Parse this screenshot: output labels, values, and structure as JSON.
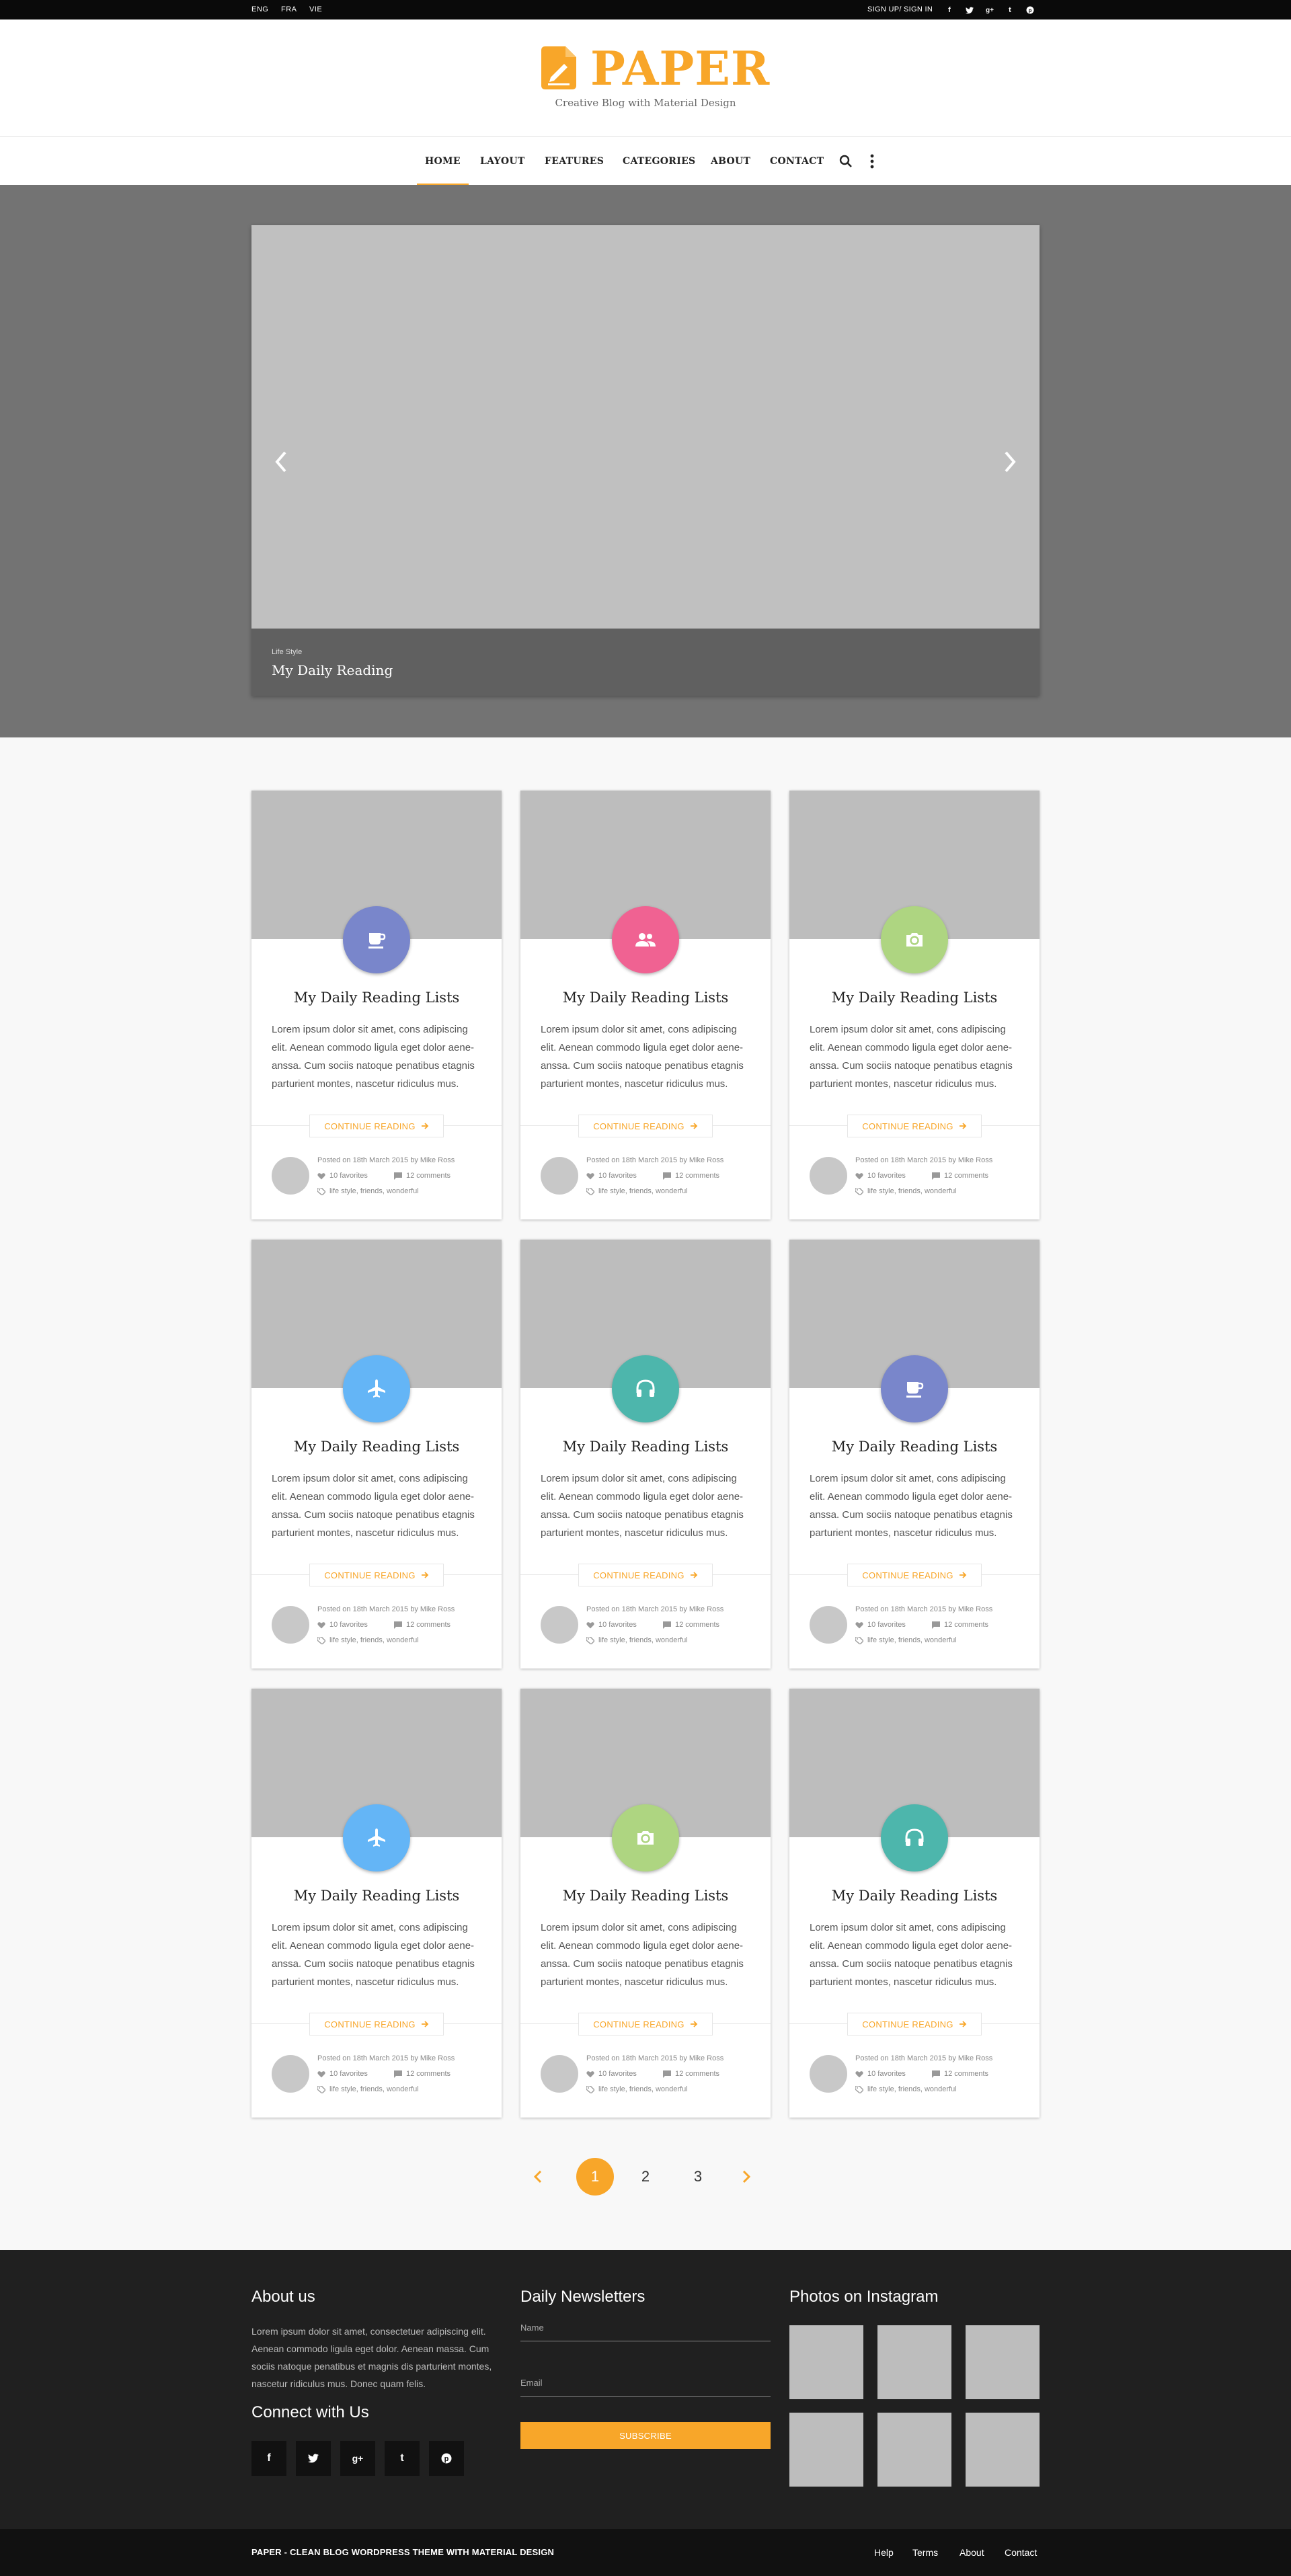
{
  "topbar": {
    "languages": [
      "ENG",
      "FRA",
      "VIE"
    ],
    "signin": "SIGN UP/ SIGN IN",
    "social_icons": [
      "facebook-icon",
      "twitter-icon",
      "google-plus-icon",
      "tumblr-icon",
      "pinterest-icon"
    ]
  },
  "header": {
    "logo": "PAPER",
    "tagline": "Creative Blog with Material Design",
    "accent_color": "#f8a629"
  },
  "nav": {
    "items": [
      "HOME",
      "LAYOUT",
      "FEATURES",
      "CATEGORIES",
      "ABOUT",
      "CONTACT"
    ],
    "active": "HOME"
  },
  "slider": {
    "category": "Life Style",
    "title": "My Daily Reading"
  },
  "cards": [
    {
      "icon": "coffee-icon",
      "color": "#7986cb",
      "title": "My Daily Reading Lists",
      "text": "Lorem ipsum dolor sit amet, cons adipiscing elit. Aenean commodo ligula eget dolor aene-anssa. Cum sociis natoque penatibus etagnis parturient montes, nascetur ridiculus mus.",
      "button": "CONTINUE READING",
      "posted": "Posted on 18th March 2015 by Mike Ross",
      "favorites": "10 favorites",
      "comments": "12 comments",
      "tags": "life style, friends, wonderful"
    },
    {
      "icon": "people-icon",
      "color": "#f06292",
      "title": "My Daily Reading Lists",
      "text": "Lorem ipsum dolor sit amet, cons adipiscing elit. Aenean commodo ligula eget dolor aene-anssa. Cum sociis natoque penatibus etagnis parturient montes, nascetur ridiculus mus.",
      "button": "CONTINUE READING",
      "posted": "Posted on 18th March 2015 by Mike Ross",
      "favorites": "10 favorites",
      "comments": "12 comments",
      "tags": "life style, friends, wonderful"
    },
    {
      "icon": "camera-icon",
      "color": "#aed581",
      "title": "My Daily Reading Lists",
      "text": "Lorem ipsum dolor sit amet, cons adipiscing elit. Aenean commodo ligula eget dolor aene-anssa. Cum sociis natoque penatibus etagnis parturient montes, nascetur ridiculus mus.",
      "button": "CONTINUE READING",
      "posted": "Posted on 18th March 2015 by Mike Ross",
      "favorites": "10 favorites",
      "comments": "12 comments",
      "tags": "life style, friends, wonderful"
    },
    {
      "icon": "airplane-icon",
      "color": "#64b5f6",
      "title": "My Daily Reading Lists",
      "text": "Lorem ipsum dolor sit amet, cons adipiscing elit. Aenean commodo ligula eget dolor aene-anssa. Cum sociis natoque penatibus etagnis parturient montes, nascetur ridiculus mus.",
      "button": "CONTINUE READING",
      "posted": "Posted on 18th March 2015 by Mike Ross",
      "favorites": "10 favorites",
      "comments": "12 comments",
      "tags": "life style, friends, wonderful"
    },
    {
      "icon": "headphones-icon",
      "color": "#4db6ac",
      "title": "My Daily Reading Lists",
      "text": "Lorem ipsum dolor sit amet, cons adipiscing elit. Aenean commodo ligula eget dolor aene-anssa. Cum sociis natoque penatibus etagnis parturient montes, nascetur ridiculus mus.",
      "button": "CONTINUE READING",
      "posted": "Posted on 18th March 2015 by Mike Ross",
      "favorites": "10 favorites",
      "comments": "12 comments",
      "tags": "life style, friends, wonderful"
    },
    {
      "icon": "coffee-icon",
      "color": "#7986cb",
      "title": "My Daily Reading Lists",
      "text": "Lorem ipsum dolor sit amet, cons adipiscing elit. Aenean commodo ligula eget dolor aene-anssa. Cum sociis natoque penatibus etagnis parturient montes, nascetur ridiculus mus.",
      "button": "CONTINUE READING",
      "posted": "Posted on 18th March 2015 by Mike Ross",
      "favorites": "10 favorites",
      "comments": "12 comments",
      "tags": "life style, friends, wonderful"
    },
    {
      "icon": "airplane-icon",
      "color": "#64b5f6",
      "title": "My Daily Reading Lists",
      "text": "Lorem ipsum dolor sit amet, cons adipiscing elit. Aenean commodo ligula eget dolor aene-anssa. Cum sociis natoque penatibus etagnis parturient montes, nascetur ridiculus mus.",
      "button": "CONTINUE READING",
      "posted": "Posted on 18th March 2015 by Mike Ross",
      "favorites": "10 favorites",
      "comments": "12 comments",
      "tags": "life style, friends, wonderful"
    },
    {
      "icon": "camera-icon",
      "color": "#aed581",
      "title": "My Daily Reading Lists",
      "text": "Lorem ipsum dolor sit amet, cons adipiscing elit. Aenean commodo ligula eget dolor aene-anssa. Cum sociis natoque penatibus etagnis parturient montes, nascetur ridiculus mus.",
      "button": "CONTINUE READING",
      "posted": "Posted on 18th March 2015 by Mike Ross",
      "favorites": "10 favorites",
      "comments": "12 comments",
      "tags": "life style, friends, wonderful"
    },
    {
      "icon": "headphones-icon",
      "color": "#4db6ac",
      "title": "My Daily Reading Lists",
      "text": "Lorem ipsum dolor sit amet, cons adipiscing elit. Aenean commodo ligula eget dolor aene-anssa. Cum sociis natoque penatibus etagnis parturient montes, nascetur ridiculus mus.",
      "button": "CONTINUE READING",
      "posted": "Posted on 18th March 2015 by Mike Ross",
      "favorites": "10 favorites",
      "comments": "12 comments",
      "tags": "life style, friends, wonderful"
    }
  ],
  "pagination": {
    "pages": [
      "1",
      "2",
      "3"
    ],
    "current": "1"
  },
  "footer": {
    "about_title": "About us",
    "about_text": "Lorem ipsum dolor sit amet, consectetuer adipiscing elit. Aenean commodo ligula eget dolor. Aenean massa. Cum sociis natoque penatibus et magnis dis parturient montes, nascetur ridiculus mus. Donec quam felis.",
    "connect_title": "Connect with Us",
    "connect_icons": [
      "facebook-icon",
      "twitter-icon",
      "google-plus-icon",
      "tumblr-icon",
      "pinterest-icon"
    ],
    "newsletter_title": "Daily Newsletters",
    "name_placeholder": "Name",
    "email_placeholder": "Email",
    "subscribe": "SUBSCRIBE",
    "instagram_title": "Photos on Instagram"
  },
  "bottom": {
    "copyright": "PAPER - CLEAN BLOG WORDPRESS THEME WITH MATERIAL DESIGN",
    "links": [
      "Help",
      "Terms",
      "About",
      "Contact"
    ]
  }
}
